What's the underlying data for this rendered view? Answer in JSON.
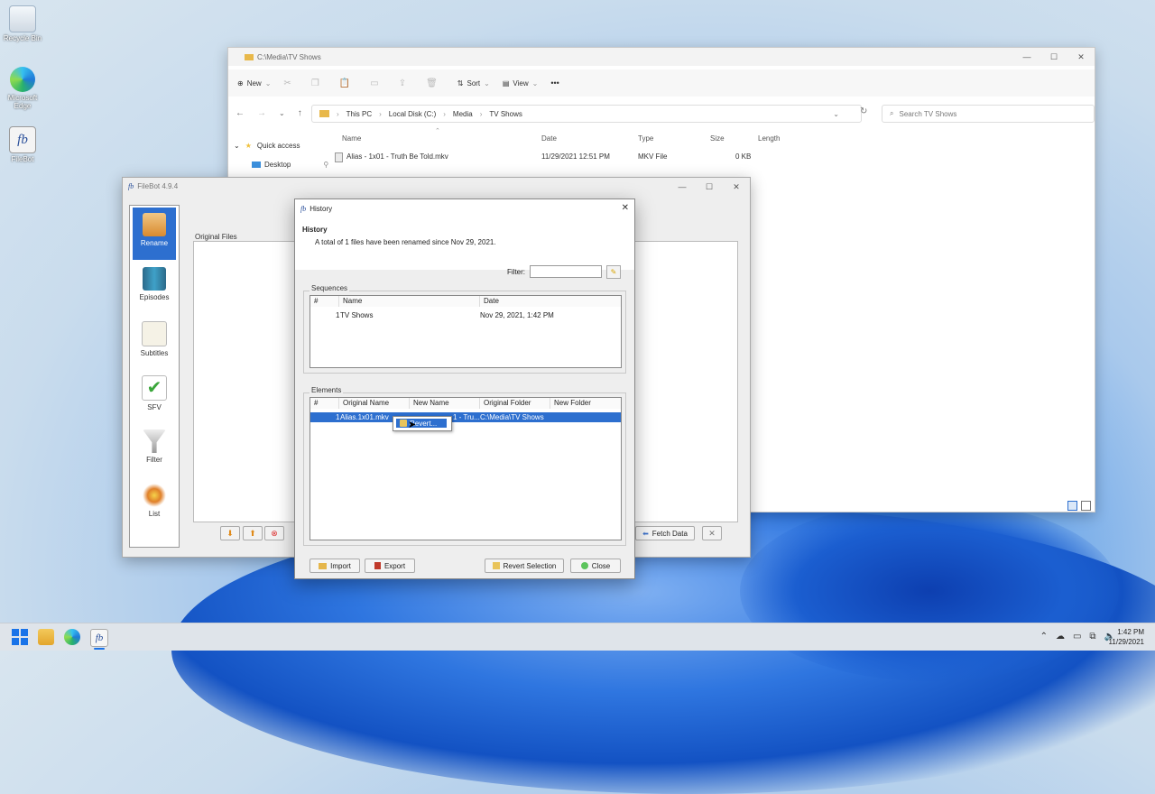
{
  "desktop": {
    "icons": [
      {
        "label": "Recycle Bin",
        "icon": "recycle-bin-icon"
      },
      {
        "label": "Microsoft Edge",
        "icon": "edge-icon"
      },
      {
        "label": "FileBot",
        "icon": "filebot-icon"
      }
    ]
  },
  "explorer": {
    "title": "C:\\Media\\TV Shows",
    "toolbar": {
      "new": "New",
      "sort": "Sort",
      "view": "View",
      "more": "•••"
    },
    "address": [
      "This PC",
      "Local Disk (C:)",
      "Media",
      "TV Shows"
    ],
    "search_placeholder": "Search TV Shows",
    "nav": {
      "quick_access": "Quick access",
      "desktop": "Desktop"
    },
    "columns": {
      "name": "Name",
      "date": "Date",
      "type": "Type",
      "size": "Size",
      "length": "Length"
    },
    "file": {
      "name": "Alias - 1x01 - Truth Be Told.mkv",
      "date": "11/29/2021 12:51 PM",
      "type": "MKV File",
      "size": "0 KB"
    }
  },
  "filebot": {
    "title": "FileBot 4.9.4",
    "sidebar": [
      "Rename",
      "Episodes",
      "Subtitles",
      "SFV",
      "Filter",
      "List"
    ],
    "original_files": "Original Files",
    "fetch_data": "Fetch Data"
  },
  "history": {
    "title": "History",
    "heading": "History",
    "summary": "A total of 1 files have been renamed since Nov 29, 2021.",
    "filter_label": "Filter:",
    "filter_value": "",
    "sequences": {
      "legend": "Sequences",
      "columns": [
        "#",
        "Name",
        "Date"
      ],
      "rows": [
        {
          "num": "1",
          "name": "TV Shows",
          "date": "Nov 29, 2021, 1:42 PM"
        }
      ]
    },
    "elements": {
      "legend": "Elements",
      "columns": [
        "#",
        "Original Name",
        "New Name",
        "Original Folder",
        "New Folder"
      ],
      "rows": [
        {
          "num": "1",
          "original": "Alias.1x01.mkv",
          "new_name": "1 - Tru...",
          "folder": "C:\\Media\\TV Shows",
          "new_folder": ""
        }
      ]
    },
    "context_menu": {
      "revert": "Revert..."
    },
    "buttons": {
      "import": "Import",
      "export": "Export",
      "revert_selection": "Revert Selection",
      "close": "Close"
    }
  },
  "taskbar": {
    "time": "1:42 PM",
    "date": "11/29/2021"
  },
  "colors": {
    "selection": "#2d6fcf",
    "taskbar": "#dfe4ea"
  }
}
